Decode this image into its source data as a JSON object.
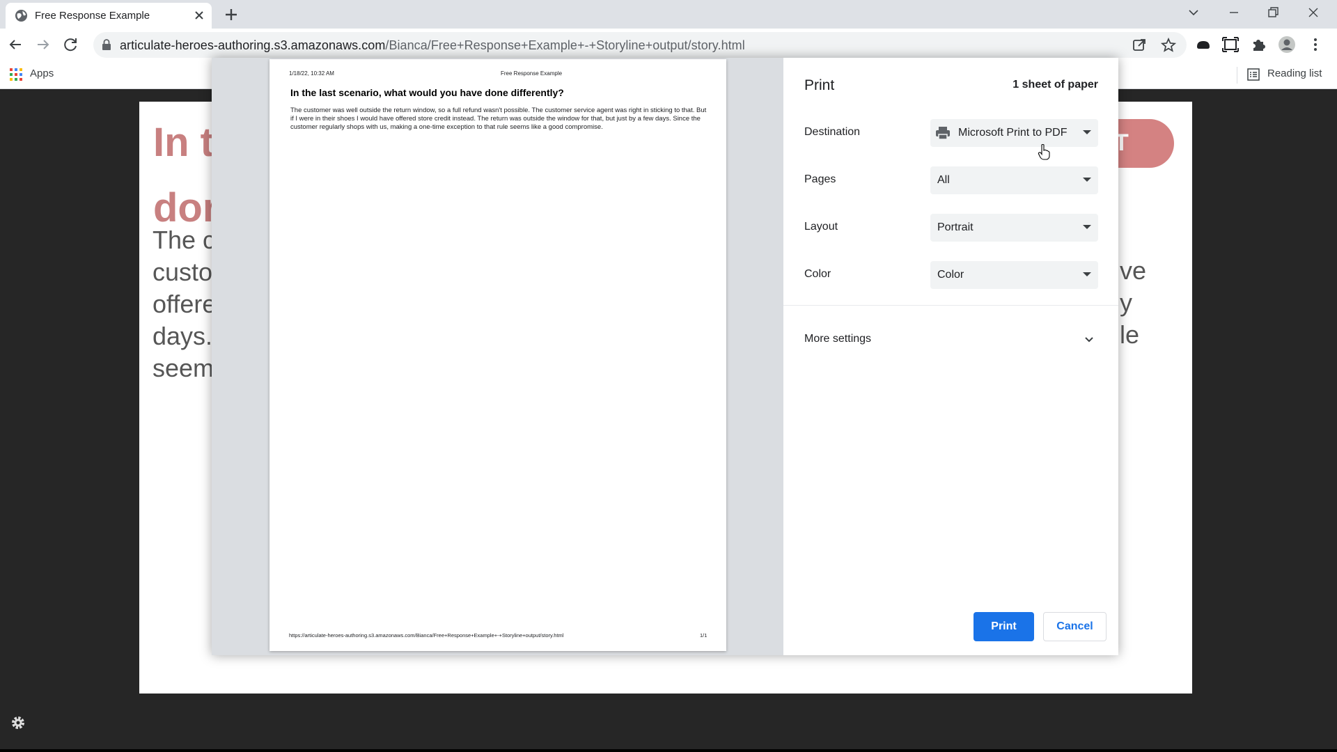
{
  "browser": {
    "tab": {
      "title": "Free Response Example"
    },
    "url": {
      "host": "articulate-heroes-authoring.s3.amazonaws.com",
      "path": "/Bianca/Free+Response+Example+-+Storyline+output/story.html"
    },
    "bookmarks": {
      "apps_label": "Apps",
      "reading_list_label": "Reading list"
    }
  },
  "course_page": {
    "title_lines": [
      "In t",
      "dor"
    ],
    "body_lines": [
      "The c",
      "custo",
      "offere",
      "days.",
      "seem"
    ],
    "submit_fragment": "T",
    "right_fragments": [
      "ve",
      "y",
      "le"
    ]
  },
  "print_dialog": {
    "preview": {
      "date": "1/18/22, 10:32 AM",
      "header_title": "Free Response Example",
      "heading": "In the last scenario, what would you have done differently?",
      "body": "The customer was well outside the return window, so a full refund wasn't possible. The customer service agent was right in sticking to that. But if I were in their shoes I would have offered store credit instead. The return was outside the window for that, but just by a few days. Since the customer regularly shops with us, making a one-time exception to that rule seems like a good compromise.",
      "footer_url": "https://articulate-heroes-authoring.s3.amazonaws.com/Bianca/Free+Response+Example+-+Storyline+output/story.html",
      "footer_page": "1/1"
    },
    "settings": {
      "title": "Print",
      "sheet_count": "1 sheet of paper",
      "destination": {
        "label": "Destination",
        "value": "Microsoft Print to PDF"
      },
      "pages": {
        "label": "Pages",
        "value": "All"
      },
      "layout": {
        "label": "Layout",
        "value": "Portrait"
      },
      "color": {
        "label": "Color",
        "value": "Color"
      },
      "more_settings": "More settings",
      "print_button": "Print",
      "cancel_button": "Cancel"
    }
  },
  "colors": {
    "accent_blue": "#1a73e8",
    "course_title": "#c88080",
    "submit_pill": "#d48282",
    "page_background": "#262626"
  }
}
